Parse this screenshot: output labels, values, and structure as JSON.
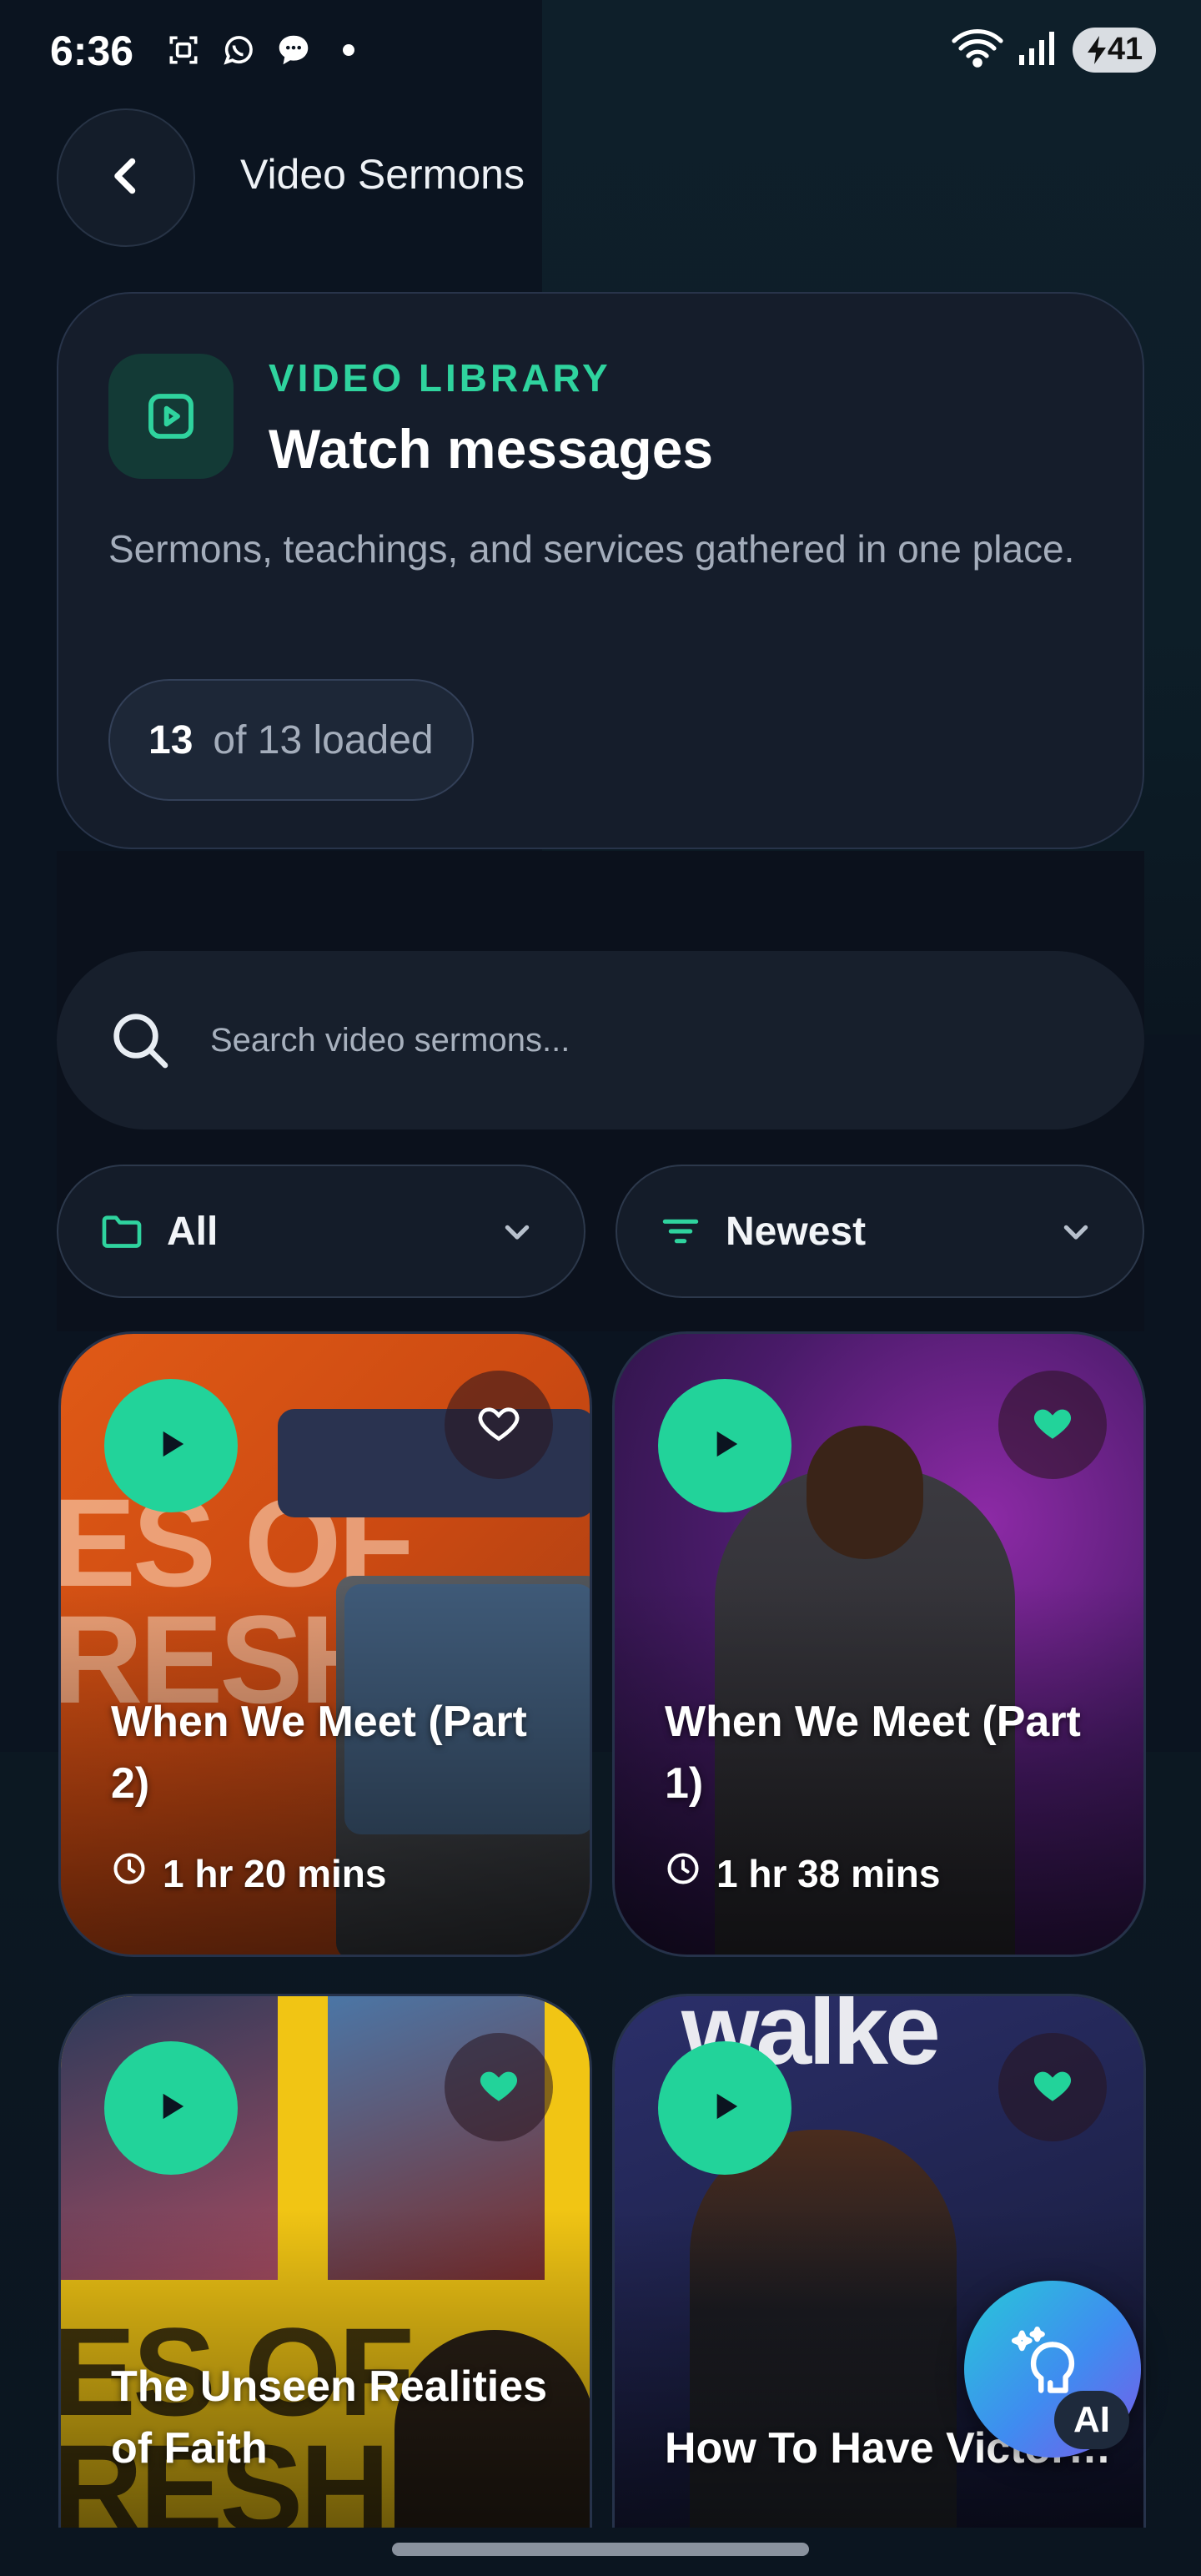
{
  "status_bar": {
    "time": "6:36",
    "battery": "41",
    "icons": [
      "screenshot-icon",
      "whatsapp-icon",
      "message-icon",
      "dot-icon",
      "wifi-icon",
      "signal-icon",
      "battery-icon"
    ]
  },
  "header": {
    "title": "Video Sermons",
    "back_icon": "chevron-left-icon"
  },
  "hero": {
    "icon": "video-play-icon",
    "eyebrow": "VIDEO LIBRARY",
    "title": "Watch messages",
    "description": "Sermons, teachings, and services gathered in one place.",
    "count_loaded": "13",
    "count_suffix": "of 13 loaded"
  },
  "search": {
    "placeholder": "Search video sermons..."
  },
  "filters": {
    "category": {
      "label": "All",
      "icon": "folder-icon"
    },
    "sort": {
      "label": "Newest",
      "icon": "sort-icon"
    }
  },
  "sermons": [
    {
      "title": "When We Meet (Part 2)",
      "duration": "1 hr 20 mins",
      "favorite": false
    },
    {
      "title": "When We Meet (Part 1)",
      "duration": "1 hr 38 mins",
      "favorite": true
    },
    {
      "title": "The Unseen Realities of Faith",
      "duration": "",
      "favorite": true
    },
    {
      "title": "How To Have Victory Over Adver...",
      "duration": "",
      "favorite": true
    }
  ],
  "ai_button": {
    "label": "AI"
  },
  "colors": {
    "accent": "#22d39a",
    "background": "#0b1420",
    "card": "#151d2b"
  }
}
